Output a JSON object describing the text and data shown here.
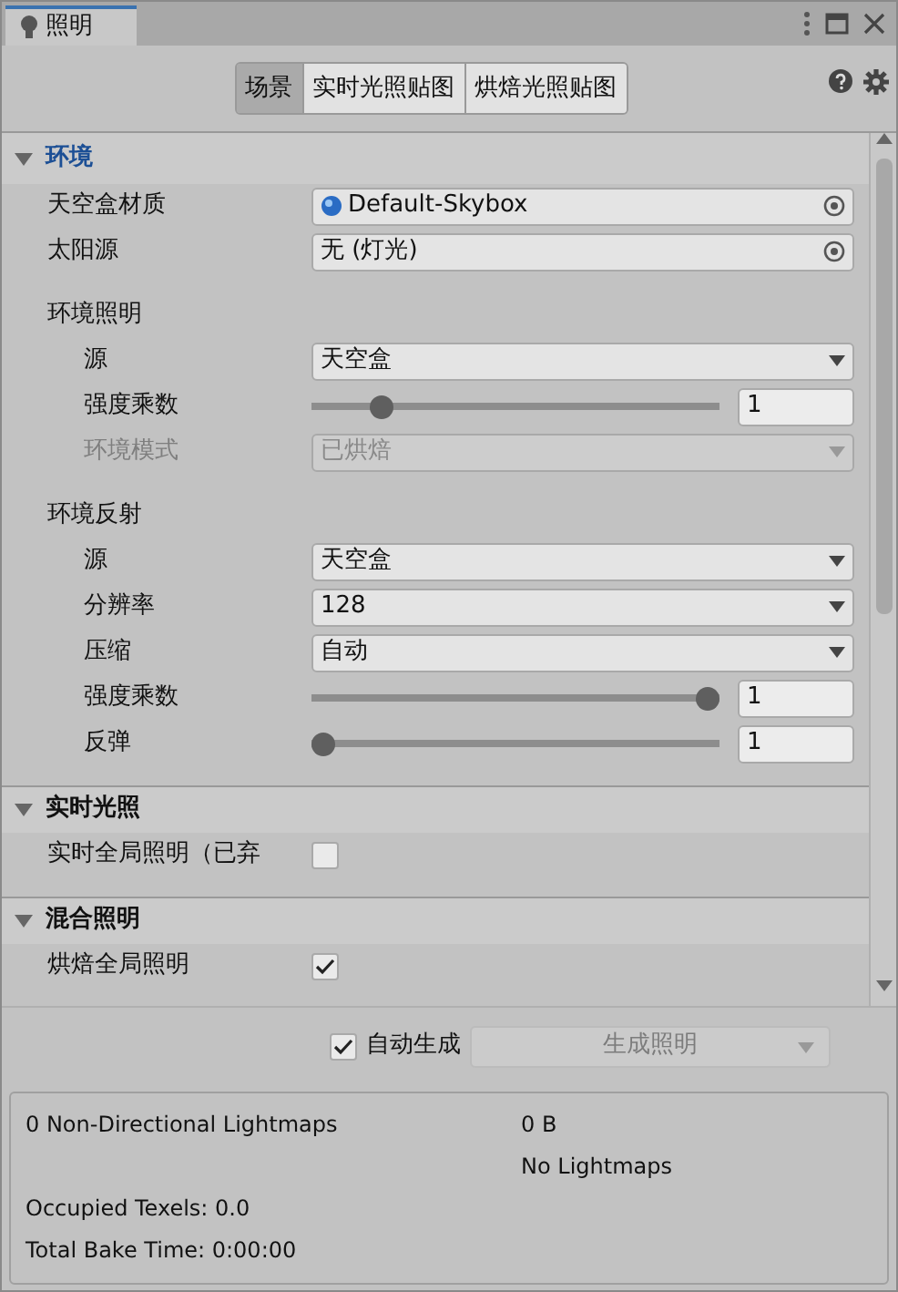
{
  "window": {
    "title": "照明"
  },
  "tabs": [
    {
      "label": "场景",
      "selected": true
    },
    {
      "label": "实时光照贴图",
      "selected": false
    },
    {
      "label": "烘焙光照贴图",
      "selected": false
    }
  ],
  "sections": [
    {
      "title": "环境",
      "expanded": true,
      "highlighted": true,
      "rows": [
        {
          "kind": "object",
          "label": "天空盒材质",
          "value": "Default-Skybox",
          "has_icon": true
        },
        {
          "kind": "object",
          "label": "太阳源",
          "value": "无 (灯光)"
        },
        {
          "kind": "group",
          "label": "环境照明"
        },
        {
          "kind": "dropdown",
          "label": "源",
          "value": "天空盒",
          "indented": true
        },
        {
          "kind": "slider",
          "label": "强度乘数",
          "level": 0.15,
          "value": "1",
          "indented": true
        },
        {
          "kind": "dropdown",
          "label": "环境模式",
          "value": "已烘焙",
          "indented": true,
          "disabled": true
        },
        {
          "kind": "group",
          "label": "环境反射"
        },
        {
          "kind": "dropdown",
          "label": "源",
          "value": "天空盒",
          "indented": true
        },
        {
          "kind": "dropdown",
          "label": "分辨率",
          "value": "128",
          "indented": true
        },
        {
          "kind": "dropdown",
          "label": "压缩",
          "value": "自动",
          "indented": true
        },
        {
          "kind": "slider",
          "label": "强度乘数",
          "level": 1,
          "value": "1",
          "indented": true
        },
        {
          "kind": "slider",
          "label": "反弹",
          "level": 0,
          "value": "1",
          "indented": true
        }
      ]
    },
    {
      "title": "实时光照",
      "expanded": true,
      "highlighted": false,
      "rows": [
        {
          "kind": "checkbox",
          "label": "实时全局照明（已弃",
          "checked": false
        }
      ]
    },
    {
      "title": "混合照明",
      "expanded": true,
      "highlighted": false,
      "rows": [
        {
          "kind": "checkbox",
          "label": "烘焙全局照明",
          "checked": true
        }
      ]
    }
  ],
  "auto_generate": {
    "label": "自动生成",
    "checked": true
  },
  "generate_button": {
    "label": "生成照明",
    "disabled": true
  },
  "stats": [
    {
      "left": "0 Non-Directional Lightmaps",
      "right": "0 B"
    },
    {
      "right": "No Lightmaps"
    },
    {
      "left": "Occupied Texels: 0.0"
    },
    {
      "left": "Total Bake Time: 0:00:00"
    }
  ]
}
